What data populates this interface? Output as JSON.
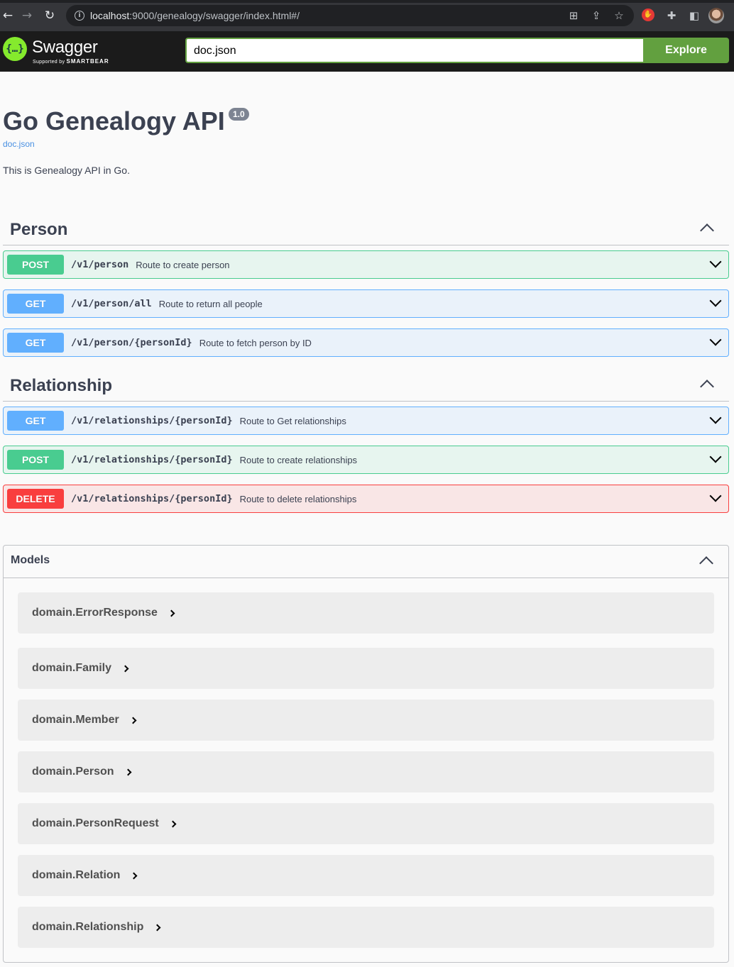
{
  "browser": {
    "url_host": "localhost",
    "url_rest": ":9000/genealogy/swagger/index.html#/"
  },
  "topbar": {
    "brand": "Swagger",
    "brand_sub_prefix": "Supported by",
    "brand_sub_name": "SMARTBEAR",
    "spec_url": "doc.json",
    "explore_label": "Explore"
  },
  "info": {
    "title": "Go Genealogy API",
    "version": "1.0",
    "spec_link": "doc.json",
    "description": "This is Genealogy API in Go."
  },
  "tags": [
    {
      "name": "Person",
      "operations": [
        {
          "method": "POST",
          "path": "/v1/person",
          "summary": "Route to create person"
        },
        {
          "method": "GET",
          "path": "/v1/person/all",
          "summary": "Route to return all people"
        },
        {
          "method": "GET",
          "path": "/v1/person/{personId}",
          "summary": "Route to fetch person by ID"
        }
      ]
    },
    {
      "name": "Relationship",
      "operations": [
        {
          "method": "GET",
          "path": "/v1/relationships/{personId}",
          "summary": "Route to Get relationships"
        },
        {
          "method": "POST",
          "path": "/v1/relationships/{personId}",
          "summary": "Route to create relationships"
        },
        {
          "method": "DELETE",
          "path": "/v1/relationships/{personId}",
          "summary": "Route to delete relationships"
        }
      ]
    }
  ],
  "models": {
    "title": "Models",
    "items": [
      "domain.ErrorResponse",
      "domain.Family",
      "domain.Member",
      "domain.Person",
      "domain.PersonRequest",
      "domain.Relation",
      "domain.Relationship"
    ]
  },
  "colors": {
    "post": "#49cc90",
    "get": "#61affe",
    "delete": "#f93e3e",
    "swagger_green": "#62a03f",
    "logo_green": "#85ea2d"
  }
}
